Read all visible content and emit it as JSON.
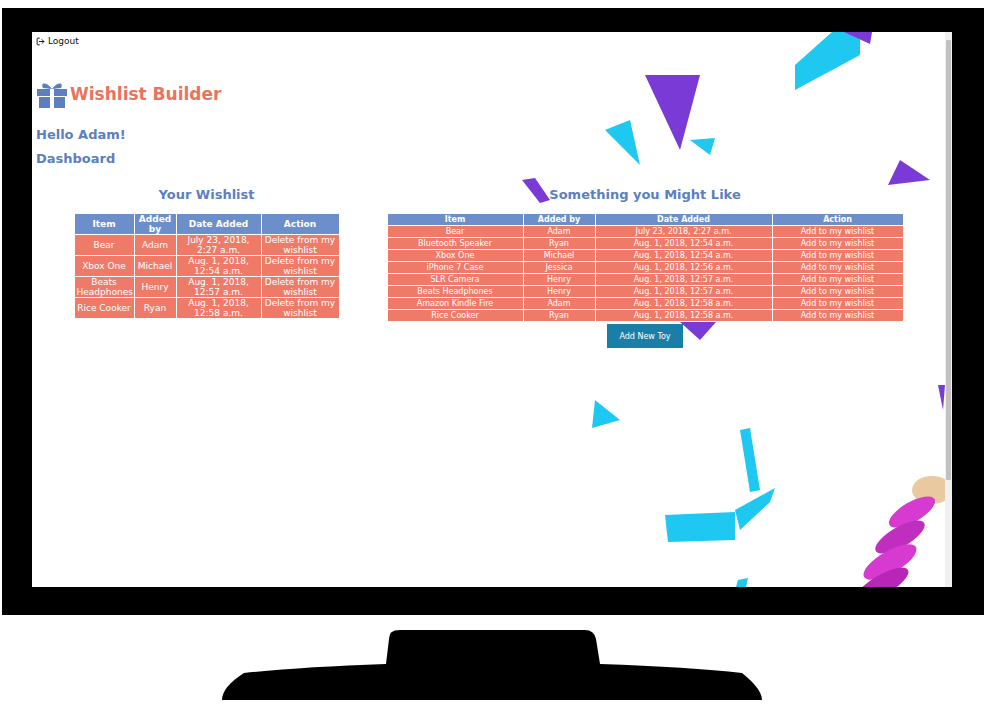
{
  "page": {
    "logout": "Logout",
    "brand": "Wishlist Builder",
    "greeting": "Hello Adam!",
    "nav": "Dashboard"
  },
  "wishlist": {
    "title": "Your Wishlist",
    "columns": [
      "Item",
      "Added by",
      "Date Added",
      "Action"
    ],
    "rows": [
      {
        "item": "Bear",
        "added_by": "Adam",
        "date": "July 23, 2018, 2:27 a.m.",
        "action": "Delete from my wishlist"
      },
      {
        "item": "Xbox One",
        "added_by": "Michael",
        "date": "Aug. 1, 2018, 12:54 a.m.",
        "action": "Delete from my wishlist"
      },
      {
        "item": "Beats Headphones",
        "added_by": "Henry",
        "date": "Aug. 1, 2018, 12:57 a.m.",
        "action": "Delete from my wishlist"
      },
      {
        "item": "Rice Cooker",
        "added_by": "Ryan",
        "date": "Aug. 1, 2018, 12:58 a.m.",
        "action": "Delete from my wishlist"
      }
    ]
  },
  "suggestions": {
    "title": "Something you Might Like",
    "columns": [
      "Item",
      "Added by",
      "Date Added",
      "Action"
    ],
    "rows": [
      {
        "item": "Bear",
        "added_by": "Adam",
        "date": "July 23, 2018, 2:27 a.m.",
        "action": "Add to my wishlist"
      },
      {
        "item": "Bluetooth Speaker",
        "added_by": "Ryan",
        "date": "Aug. 1, 2018, 12:54 a.m.",
        "action": "Add to my wishlist"
      },
      {
        "item": "Xbox One",
        "added_by": "Michael",
        "date": "Aug. 1, 2018, 12:54 a.m.",
        "action": "Add to my wishlist"
      },
      {
        "item": "iPhone 7 Case",
        "added_by": "Jessica",
        "date": "Aug. 1, 2018, 12:56 a.m.",
        "action": "Add to my wishlist"
      },
      {
        "item": "SLR Camera",
        "added_by": "Henry",
        "date": "Aug. 1, 2018, 12:57 a.m.",
        "action": "Add to my wishlist"
      },
      {
        "item": "Beats Headphones",
        "added_by": "Henry",
        "date": "Aug. 1, 2018, 12:57 a.m.",
        "action": "Add to my wishlist"
      },
      {
        "item": "Amazon Kindle Fire",
        "added_by": "Adam",
        "date": "Aug. 1, 2018, 12:58 a.m.",
        "action": "Add to my wishlist"
      },
      {
        "item": "Rice Cooker",
        "added_by": "Ryan",
        "date": "Aug. 1, 2018, 12:58 a.m.",
        "action": "Add to my wishlist"
      }
    ],
    "button": "Add New Toy"
  }
}
